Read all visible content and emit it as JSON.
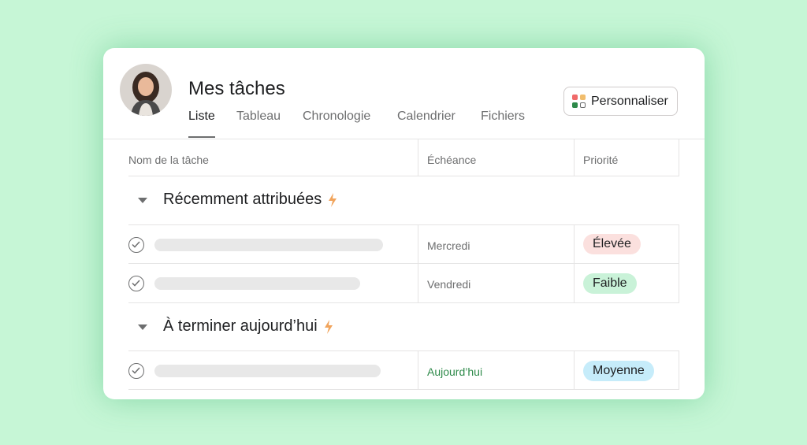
{
  "header": {
    "title": "Mes tâches",
    "tabs": [
      "Liste",
      "Tableau",
      "Chronologie",
      "Calendrier",
      "Fichiers"
    ],
    "active_tab": "Liste",
    "customize_label": "Personnaliser"
  },
  "table": {
    "columns": [
      "Nom de la tâche",
      "Échéance",
      "Priorité"
    ]
  },
  "sections": [
    {
      "title": "Récemment attribuées",
      "icon": "lightning-icon",
      "tasks": [
        {
          "due": "Mercredi",
          "priority": "Élevée",
          "priority_color": "#fbe0de"
        },
        {
          "due": "Vendredi",
          "priority": "Faible",
          "priority_color": "#c9f2d8"
        }
      ]
    },
    {
      "title": "À terminer aujourd’hui",
      "icon": "lightning-icon",
      "tasks": [
        {
          "due": "Aujourd’hui",
          "priority": "Moyenne",
          "priority_color": "#c6ecfa"
        }
      ]
    }
  ],
  "colors": {
    "background": "#c6f6d6",
    "accent_today": "#2e8a4a",
    "bolt": "#f1a45c"
  }
}
